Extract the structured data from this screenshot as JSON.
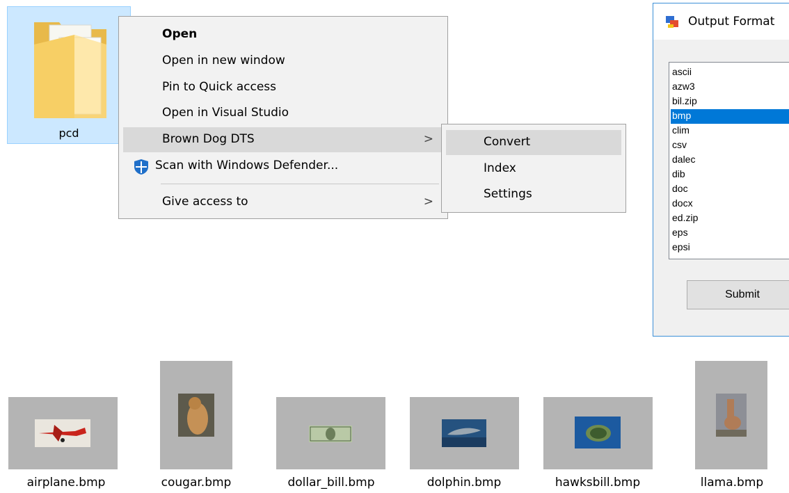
{
  "folder": {
    "name": "pcd",
    "icon": "folder-icon"
  },
  "context_menu": {
    "items": [
      {
        "label": "Open",
        "bold": true
      },
      {
        "label": "Open in new window"
      },
      {
        "label": "Pin to Quick access"
      },
      {
        "label": "Open in Visual Studio"
      },
      {
        "label": "Brown Dog DTS",
        "has_submenu": true,
        "highlighted": true
      },
      {
        "label": "Scan with Windows Defender...",
        "icon": "shield-icon"
      },
      {
        "label": "Give access to",
        "has_submenu": true
      }
    ]
  },
  "submenu": {
    "items": [
      {
        "label": "Convert",
        "highlighted": true
      },
      {
        "label": "Index"
      },
      {
        "label": "Settings"
      }
    ]
  },
  "output_window": {
    "title": "Output Format",
    "formats": [
      "ascii",
      "azw3",
      "bil.zip",
      "bmp",
      "clim",
      "csv",
      "dalec",
      "dib",
      "doc",
      "docx",
      "ed.zip",
      "eps",
      "epsi"
    ],
    "selected": "bmp",
    "submit_label": "Submit"
  },
  "files": [
    {
      "name": "airplane.bmp"
    },
    {
      "name": "cougar.bmp"
    },
    {
      "name": "dollar_bill.bmp"
    },
    {
      "name": "dolphin.bmp"
    },
    {
      "name": "hawksbill.bmp"
    },
    {
      "name": "llama.bmp"
    }
  ],
  "colors": {
    "selection_blue": "#0078d7",
    "folder_selected_bg": "#cce8ff",
    "menu_bg": "#f2f2f2",
    "menu_hover": "#d9d9d9",
    "window_border": "#3c8fd7",
    "thumb_bg": "#b4b4b4"
  }
}
